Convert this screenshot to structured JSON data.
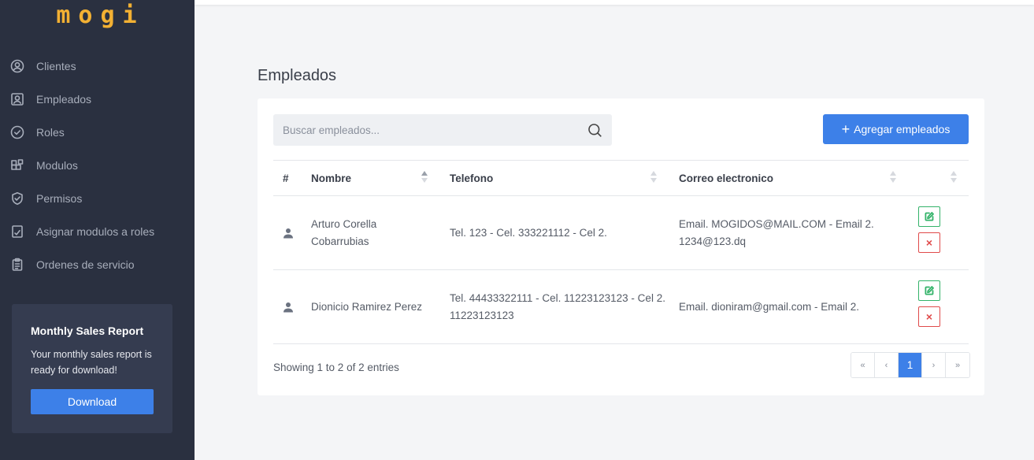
{
  "app": {
    "logo": "mogi"
  },
  "sidebar": {
    "items": [
      {
        "label": "Clientes",
        "icon": "user-circle-icon"
      },
      {
        "label": "Empleados",
        "icon": "user-square-icon"
      },
      {
        "label": "Roles",
        "icon": "check-circle-icon"
      },
      {
        "label": "Modulos",
        "icon": "modules-icon"
      },
      {
        "label": "Permisos",
        "icon": "shield-check-icon"
      },
      {
        "label": "Asignar modulos a roles",
        "icon": "file-check-icon"
      },
      {
        "label": "Ordenes de servicio",
        "icon": "clipboard-icon"
      }
    ],
    "promo": {
      "title": "Monthly Sales Report",
      "text": "Your monthly sales report is ready for download!",
      "button": "Download"
    }
  },
  "main": {
    "title": "Empleados",
    "search": {
      "placeholder": "Buscar empleados..."
    },
    "add_button": "Agregar empleados",
    "table": {
      "columns": [
        "#",
        "Nombre",
        "Telefono",
        "Correo electronico"
      ],
      "rows": [
        {
          "nombre": "Arturo Corella Cobarrubias",
          "telefono": "Tel. 123 - Cel. 333221112 - Cel 2.",
          "correo": "Email. MOGIDOS@MAIL.COM - Email 2. 1234@123.dq"
        },
        {
          "nombre": "Dionicio Ramirez Perez",
          "telefono": "Tel. 44433322111 - Cel. 11223123123 - Cel 2. 11223123123",
          "correo": "Email. dioniram@gmail.com - Email 2."
        }
      ]
    },
    "info": "Showing 1 to 2 of 2 entries",
    "pagination": {
      "first": "«",
      "prev": "‹",
      "current": "1",
      "next": "›",
      "last": "»"
    }
  },
  "colors": {
    "sidebar": "#2a3040",
    "accent": "#3d80e8",
    "logo": "#f2b033",
    "edit": "#34b36a",
    "delete": "#e04b4b"
  }
}
